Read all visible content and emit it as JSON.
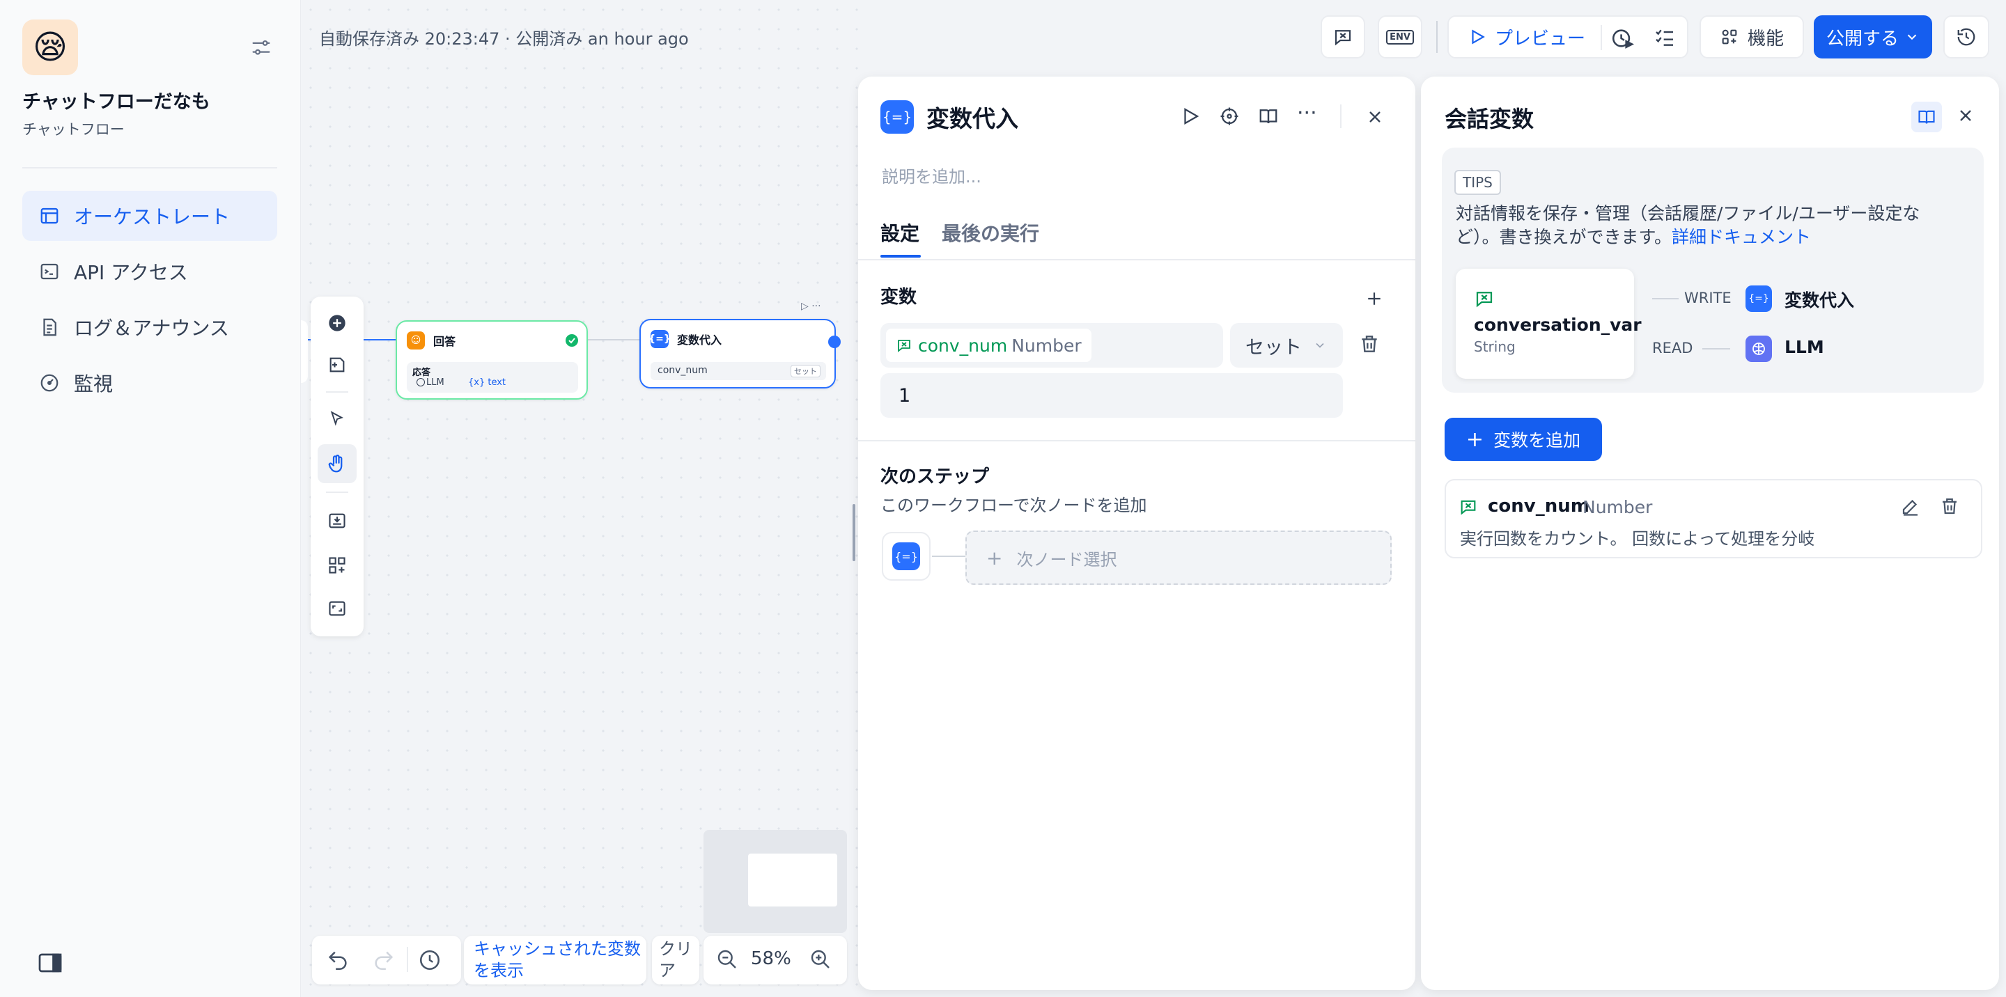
{
  "app": {
    "icon": "😪",
    "name": "チャットフローだなも",
    "type": "チャットフロー"
  },
  "nav": [
    {
      "label": "オーケストレート",
      "icon": "layout-icon"
    },
    {
      "label": "API アクセス",
      "icon": "terminal-icon"
    },
    {
      "label": "ログ＆アナウンス",
      "icon": "document-icon"
    },
    {
      "label": "監視",
      "icon": "gauge-icon"
    }
  ],
  "header": {
    "status": "自動保存済み 20:23:47 · 公開済み an hour ago",
    "env_label": "ENV",
    "preview_label": "プレビュー",
    "features_label": "機能",
    "publish_label": "公開する"
  },
  "canvas": {
    "answer_node": {
      "title": "回答",
      "sub_label": "応答",
      "llm_tag": "LLM",
      "var_tag": "text"
    },
    "assign_node": {
      "title": "変数代入",
      "var": "conv_num",
      "op": "セット"
    },
    "cache_link": "キャッシュされた変数を表示",
    "clear_label": "クリア",
    "zoom": "58%"
  },
  "panel": {
    "title": "変数代入",
    "description_placeholder": "説明を追加...",
    "tabs": [
      "設定",
      "最後の実行"
    ],
    "variables_label": "変数",
    "var_name": "conv_num",
    "var_type": "Number",
    "operation": "セット",
    "value": "1",
    "next_step_title": "次のステップ",
    "next_step_desc": "このワークフローで次ノードを追加",
    "next_node_label": "次ノード選択"
  },
  "conv_panel": {
    "title": "会話変数",
    "tips_badge": "TIPS",
    "tips_text": "対話情報を保存・管理（会話履歴/ファイル/ユーザー設定など）。書き換えができます。",
    "tips_link": "詳細ドキュメント",
    "card_var_name": "conversation_var",
    "card_var_type": "String",
    "write_label": "WRITE",
    "write_node": "変数代入",
    "read_label": "READ",
    "read_node": "LLM",
    "add_button": "変数を追加",
    "variables": [
      {
        "name": "conv_num",
        "type": "Number",
        "description": "実行回数をカウント。 回数によって処理を分岐"
      }
    ]
  },
  "colors": {
    "accent": "#155eef",
    "answer_orange": "#f79009",
    "llm_purple": "#6172f3",
    "success_green": "#12b76a"
  }
}
